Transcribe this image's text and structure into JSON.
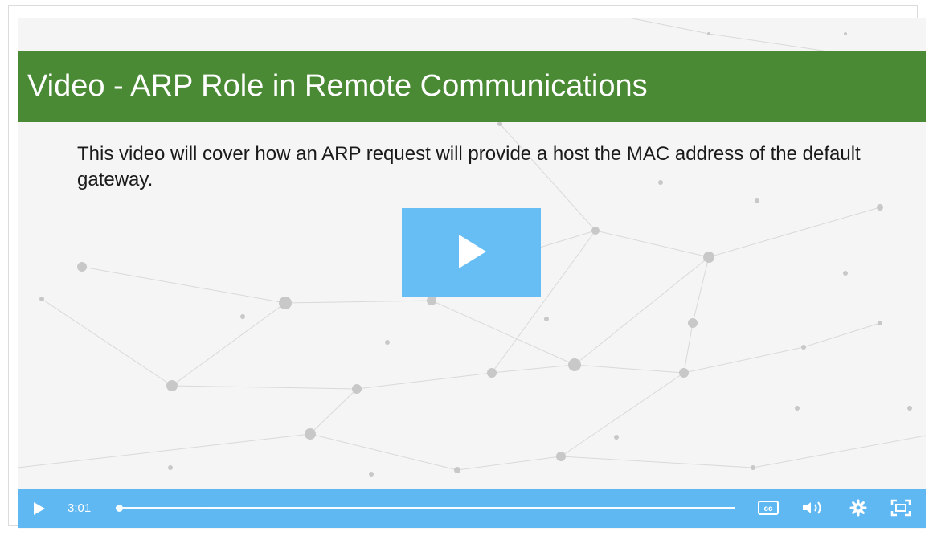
{
  "slide": {
    "title": "Video - ARP Role in Remote Communications",
    "description": "This video will cover how an ARP request will provide a host the MAC address of the default gateway."
  },
  "player": {
    "time_display": "3:01",
    "progress": 0.0,
    "accent_color": "#60b8f2",
    "title_bar_color": "#4a8a35",
    "icons": [
      "play-icon",
      "closed-captions-icon",
      "volume-icon",
      "settings-gear-icon",
      "fullscreen-icon"
    ]
  }
}
